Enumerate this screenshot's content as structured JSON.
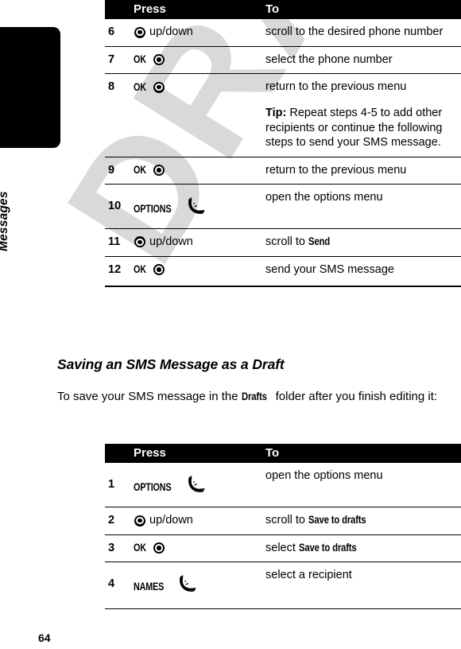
{
  "page": {
    "number": "64",
    "chapter_label": "Messages",
    "watermark_text": "DRAFT"
  },
  "table1": {
    "name": "sending-sms-steps-table",
    "headers": {
      "num": "",
      "press": "Press",
      "to": "To"
    },
    "rows": [
      {
        "num": "6",
        "press_key_label": "",
        "press_icon": "nav-key-icon",
        "press_text": "up/down",
        "to": "scroll to the desired phone number"
      },
      {
        "num": "7",
        "press_key_label": "OK",
        "press_icon": "nav-key-icon",
        "press_text": "",
        "to": "select the phone number"
      },
      {
        "num": "8",
        "press_key_label": "OK",
        "press_icon": "nav-key-icon",
        "press_text": "",
        "to": "return to the previous menu",
        "tip_lead": "Tip:",
        "tip_body": " Repeat steps 4-5 to add other recipients or continue the following steps to send your SMS message."
      },
      {
        "num": "9",
        "press_key_label": "OK",
        "press_icon": "nav-key-icon",
        "press_text": "",
        "to": "return to the previous menu"
      },
      {
        "num": "10",
        "press_key_label": "OPTIONS",
        "press_icon": "soft-key-icon",
        "press_text": "",
        "to": "open the options menu"
      },
      {
        "num": "11",
        "press_key_label": "",
        "press_icon": "nav-key-icon",
        "press_text": "up/down",
        "to_prefix": "scroll to ",
        "to_bold": "Send"
      },
      {
        "num": "12",
        "press_key_label": "OK",
        "press_icon": "nav-key-icon",
        "press_text": "",
        "to": "send your SMS message"
      }
    ]
  },
  "section": {
    "heading": "Saving an SMS Message as a Draft",
    "para_part1": "To save your SMS message in the ",
    "para_bold": "Drafts",
    "para_part2": " folder after you finish editing it:"
  },
  "table2": {
    "name": "save-draft-steps-table",
    "headers": {
      "num": "",
      "press": "Press",
      "to": "To"
    },
    "rows": [
      {
        "num": "1",
        "press_key_label": "OPTIONS",
        "press_icon": "soft-key-icon",
        "press_text": "",
        "to": "open the options menu"
      },
      {
        "num": "2",
        "press_key_label": "",
        "press_icon": "nav-key-icon",
        "press_text": "up/down",
        "to_prefix": "scroll to ",
        "to_bold": "Save to drafts"
      },
      {
        "num": "3",
        "press_key_label": "OK",
        "press_icon": "nav-key-icon",
        "press_text": "",
        "to_prefix": "select ",
        "to_bold": "Save to drafts"
      },
      {
        "num": "4",
        "press_key_label": "NAMES",
        "press_icon": "soft-key-icon",
        "press_text": "",
        "to": "select a recipient"
      }
    ]
  },
  "colors": {
    "ink": "#000000",
    "paper": "#ffffff",
    "watermark": "#d9d9d9"
  }
}
